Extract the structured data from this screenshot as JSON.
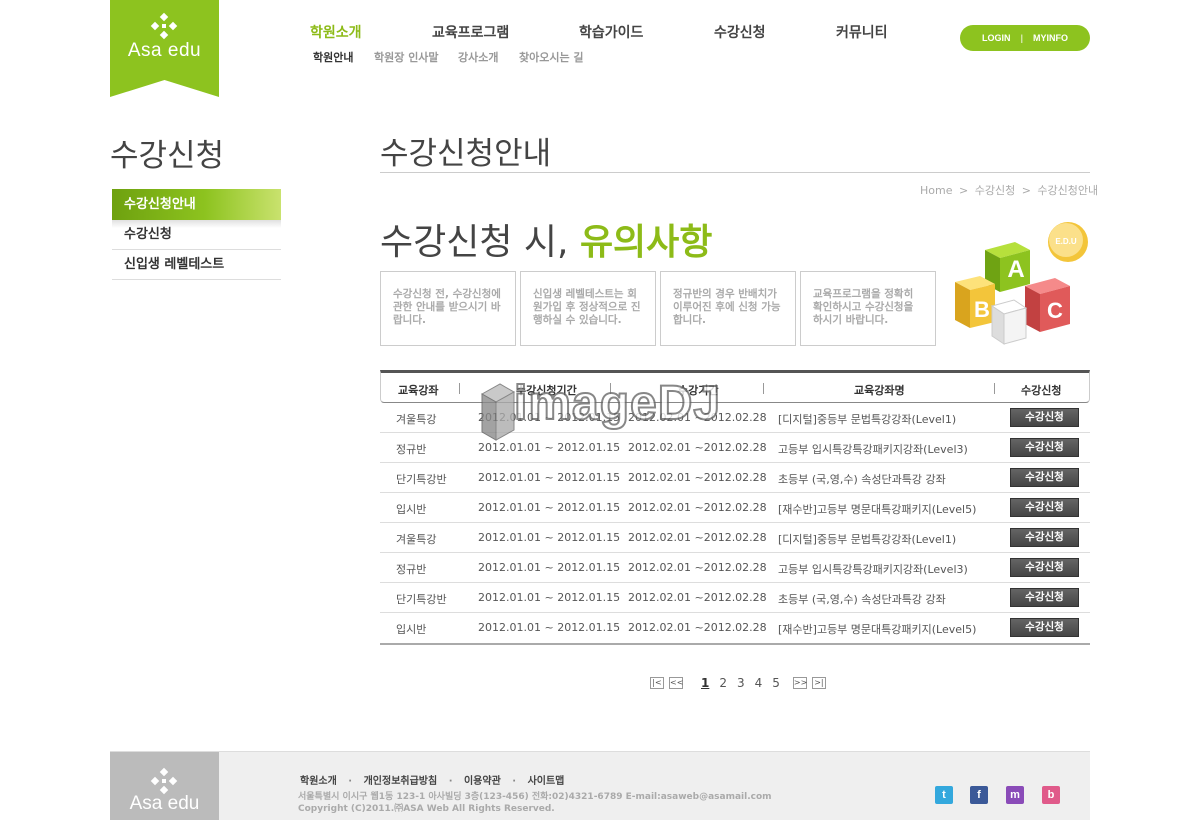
{
  "brand": {
    "logo_text": "Asa edu"
  },
  "gnb": {
    "items": [
      {
        "label": "학원소개",
        "active": true
      },
      {
        "label": "교육프로그램"
      },
      {
        "label": "학습가이드"
      },
      {
        "label": "수강신청"
      },
      {
        "label": "커뮤니티"
      }
    ],
    "sub_items": [
      {
        "label": "학원안내",
        "active": true
      },
      {
        "label": "학원장 인사말"
      },
      {
        "label": "강사소개"
      },
      {
        "label": "찾아오시는 길"
      }
    ]
  },
  "account": {
    "login": "LOGIN",
    "sep": "|",
    "myinfo": "MYINFO"
  },
  "sidebar": {
    "title": "수강신청",
    "items": [
      {
        "label": "수강신청안내",
        "active": true
      },
      {
        "label": "수강신청"
      },
      {
        "label": "신입생 레벨테스트"
      }
    ]
  },
  "main": {
    "title": "수강신청안내",
    "breadcrumb": [
      "Home",
      "수강신청",
      "수강신청안내"
    ],
    "breadcrumb_sep": ">",
    "headline": "수강신청 시, ",
    "headline_accent": "유의사항",
    "notices": [
      "수강신청 전, 수강신청에 관한 안내를 받으시기 바랍니다.",
      "신입생 레벨테스트는 회원가입 후 정상적으로 진행하실 수 있습니다.",
      "정규반의 경우 반배치가 이루어진 후에 신청 가능 합니다.",
      "교육프로그램을 정확히 확인하시고 수강신청을 하시기 바랍니다."
    ],
    "illustration": {
      "badge": "E.D.U",
      "blocks": [
        "A",
        "B",
        "C"
      ]
    }
  },
  "table": {
    "headers": [
      "교육강좌",
      "수강신청기간",
      "수강기간",
      "교육강좌명",
      "수강신청"
    ],
    "rows": [
      {
        "type": "겨울특강",
        "apply": "2012.01.01 ~ 2012.01.15",
        "period": "2012.02.01 ~2012.02.28",
        "name": "[디지털]중등부 문법특강강좌(Level1)",
        "action": "수강신청"
      },
      {
        "type": "정규반",
        "apply": "2012.01.01 ~ 2012.01.15",
        "period": "2012.02.01 ~2012.02.28",
        "name": "고등부 입시특강특강패키지강좌(Level3)",
        "action": "수강신청"
      },
      {
        "type": "단기특강반",
        "apply": "2012.01.01 ~ 2012.01.15",
        "period": "2012.02.01 ~2012.02.28",
        "name": "초등부 (국,영,수) 속성단과특강 강좌",
        "action": "수강신청"
      },
      {
        "type": "입시반",
        "apply": "2012.01.01 ~ 2012.01.15",
        "period": "2012.02.01 ~2012.02.28",
        "name": "[재수반]고등부 명문대특강패키지(Level5)",
        "action": "수강신청"
      },
      {
        "type": "겨울특강",
        "apply": "2012.01.01 ~ 2012.01.15",
        "period": "2012.02.01 ~2012.02.28",
        "name": "[디지털]중등부 문법특강강좌(Level1)",
        "action": "수강신청"
      },
      {
        "type": "정규반",
        "apply": "2012.01.01 ~ 2012.01.15",
        "period": "2012.02.01 ~2012.02.28",
        "name": "고등부 입시특강특강패키지강좌(Level3)",
        "action": "수강신청"
      },
      {
        "type": "단기특강반",
        "apply": "2012.01.01 ~ 2012.01.15",
        "period": "2012.02.01 ~2012.02.28",
        "name": "초등부 (국,영,수) 속성단과특강 강좌",
        "action": "수강신청"
      },
      {
        "type": "입시반",
        "apply": "2012.01.01 ~ 2012.01.15",
        "period": "2012.02.01 ~2012.02.28",
        "name": "[재수반]고등부 명문대특강패키지(Level5)",
        "action": "수강신청"
      }
    ]
  },
  "pagination": {
    "first": "|<",
    "prev": "<<",
    "pages": [
      "1",
      "2",
      "3",
      "4",
      "5"
    ],
    "current": "1",
    "next": ">>",
    "last": ">|"
  },
  "watermark": {
    "text": "imageDJ"
  },
  "footer": {
    "links": [
      "학원소개",
      "개인정보취급방침",
      "이용약관",
      "사이트맵"
    ],
    "link_sep": "·",
    "address": "서울특별시 이시구 웹1동 123-1 아사빌딩 3층(123-456) 전화:02)4321-6789 E-mail:asaweb@asamail.com",
    "copyright": "Copyright (C)2011.㈜ASA Web All Rights Reserved.",
    "sns": [
      {
        "name": "twitter-icon",
        "glyph": "t",
        "color": "#33a8dd"
      },
      {
        "name": "facebook-icon",
        "glyph": "f",
        "color": "#3b5998"
      },
      {
        "name": "me2day-icon",
        "glyph": "m",
        "color": "#8a4bb8"
      },
      {
        "name": "blog-icon",
        "glyph": "b",
        "color": "#e05a8a"
      }
    ]
  },
  "colors": {
    "accent": "#8dc31f",
    "accent_text": "#8dbb18",
    "dark_button": "#555555",
    "footer_bg": "#efefef"
  }
}
